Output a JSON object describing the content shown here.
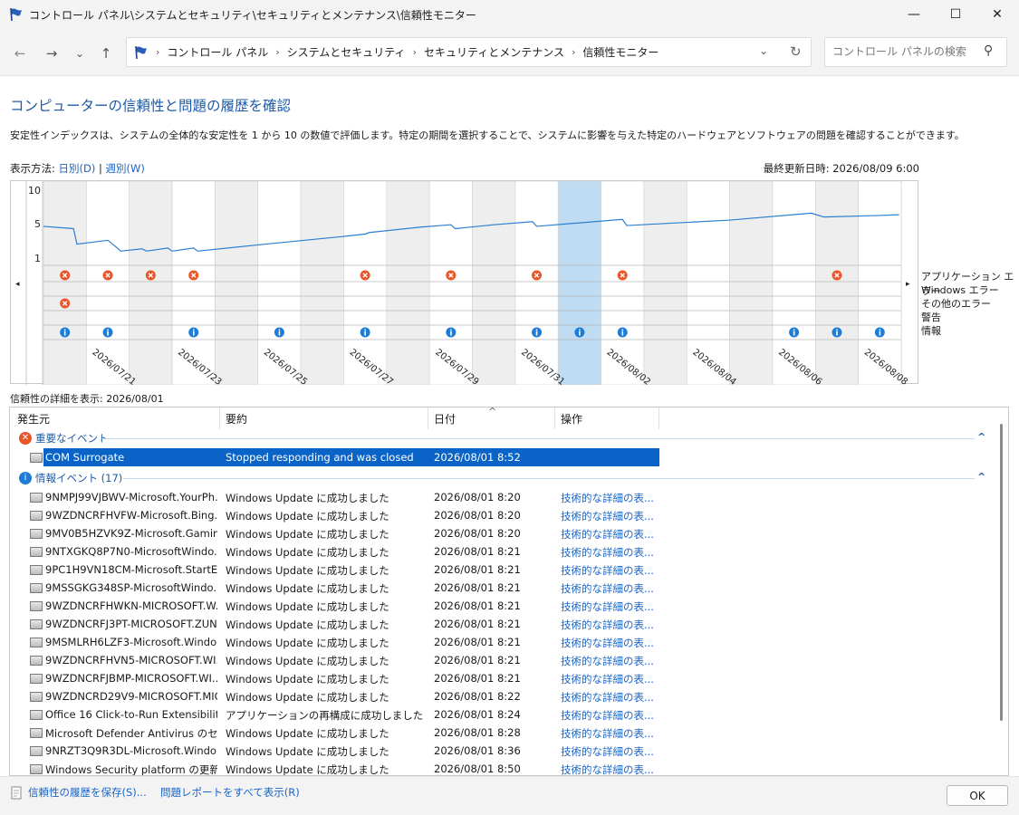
{
  "window": {
    "title": "コントロール パネル\\システムとセキュリティ\\セキュリティとメンテナンス\\信頼性モニター",
    "controls": {
      "minimize": "—",
      "maximize": "☐",
      "close": "✕"
    }
  },
  "nav": {
    "back": "←",
    "forward": "→",
    "recent": "⌄",
    "up": "↑",
    "breadcrumbs": [
      "コントロール パネル",
      "システムとセキュリティ",
      "セキュリティとメンテナンス",
      "信頼性モニター"
    ],
    "dropdown": "⌄",
    "refresh": "↻",
    "search_placeholder": "コントロール パネルの検索",
    "search_icon": "⚲"
  },
  "page": {
    "heading": "コンピューターの信頼性と問題の履歴を確認",
    "description": "安定性インデックスは、システムの全体的な安定性を 1 から 10 の数値で評価します。特定の期間を選択することで、システムに影響を与えた特定のハードウェアとソフトウェアの問題を確認することができます。",
    "view_label": "表示方法:",
    "view_daily": "日別(D)",
    "view_sep": "|",
    "view_weekly": "週別(W)",
    "last_updated_label": "最終更新日時:",
    "last_updated_value": "2026/08/09 6:00",
    "detail_label": "信頼性の詳細を表示:",
    "detail_date": "2026/08/01"
  },
  "chart_data": {
    "type": "line",
    "y_ticks": [
      "10",
      "5",
      "1"
    ],
    "ylim": [
      1,
      10
    ],
    "x_tick_labels": [
      "2026/07/21",
      "2026/07/23",
      "2026/07/25",
      "2026/07/27",
      "2026/07/29",
      "2026/07/31",
      "2026/08/02",
      "2026/08/04",
      "2026/08/06",
      "2026/08/08"
    ],
    "selected_day": "2026/08/01",
    "legend": [
      "アプリケーション エラー",
      "Windows エラー",
      "その他のエラー",
      "警告",
      "情報"
    ],
    "scroll_left": "◂",
    "scroll_right": "▸"
  },
  "list": {
    "columns": [
      "発生元",
      "要約",
      "日付",
      "操作"
    ],
    "sort_indicator": "^",
    "critical_group": {
      "label": "重要なイベント",
      "icon": "✕",
      "collapse": "^"
    },
    "info_group": {
      "label": "情報イベント (17)",
      "icon": "i",
      "collapse": "^"
    },
    "critical_rows": [
      {
        "source": "COM Surrogate",
        "summary": "Stopped responding and was closed",
        "date": "2026/08/01 8:52",
        "action": ""
      }
    ],
    "info_rows": [
      {
        "source": "9NMPJ99VJBWV-Microsoft.YourPh...",
        "summary": "Windows Update に成功しました",
        "date": "2026/08/01 8:20",
        "action": "技術的な詳細の表..."
      },
      {
        "source": "9WZDNCRFHVFW-Microsoft.Bing...",
        "summary": "Windows Update に成功しました",
        "date": "2026/08/01 8:20",
        "action": "技術的な詳細の表..."
      },
      {
        "source": "9MV0B5HZVK9Z-Microsoft.Gamin...",
        "summary": "Windows Update に成功しました",
        "date": "2026/08/01 8:20",
        "action": "技術的な詳細の表..."
      },
      {
        "source": "9NTXGKQ8P7N0-MicrosoftWindo...",
        "summary": "Windows Update に成功しました",
        "date": "2026/08/01 8:21",
        "action": "技術的な詳細の表..."
      },
      {
        "source": "9PC1H9VN18CM-Microsoft.StartE...",
        "summary": "Windows Update に成功しました",
        "date": "2026/08/01 8:21",
        "action": "技術的な詳細の表..."
      },
      {
        "source": "9MSSGKG348SP-MicrosoftWindo...",
        "summary": "Windows Update に成功しました",
        "date": "2026/08/01 8:21",
        "action": "技術的な詳細の表..."
      },
      {
        "source": "9WZDNCRFHWKN-MICROSOFT.W...",
        "summary": "Windows Update に成功しました",
        "date": "2026/08/01 8:21",
        "action": "技術的な詳細の表..."
      },
      {
        "source": "9WZDNCRFJ3PT-MICROSOFT.ZUN...",
        "summary": "Windows Update に成功しました",
        "date": "2026/08/01 8:21",
        "action": "技術的な詳細の表..."
      },
      {
        "source": "9MSMLRH6LZF3-Microsoft.Windo...",
        "summary": "Windows Update に成功しました",
        "date": "2026/08/01 8:21",
        "action": "技術的な詳細の表..."
      },
      {
        "source": "9WZDNCRFHVN5-MICROSOFT.WI...",
        "summary": "Windows Update に成功しました",
        "date": "2026/08/01 8:21",
        "action": "技術的な詳細の表..."
      },
      {
        "source": "9WZDNCRFJBMP-MICROSOFT.WI...",
        "summary": "Windows Update に成功しました",
        "date": "2026/08/01 8:21",
        "action": "技術的な詳細の表..."
      },
      {
        "source": "9WZDNCRD29V9-MICROSOFT.MIC...",
        "summary": "Windows Update に成功しました",
        "date": "2026/08/01 8:22",
        "action": "技術的な詳細の表..."
      },
      {
        "source": "Office 16 Click-to-Run Extensibilit...",
        "summary": "アプリケーションの再構成に成功しました",
        "date": "2026/08/01 8:24",
        "action": "技術的な詳細の表..."
      },
      {
        "source": "Microsoft Defender Antivirus のセ...",
        "summary": "Windows Update に成功しました",
        "date": "2026/08/01 8:28",
        "action": "技術的な詳細の表..."
      },
      {
        "source": "9NRZT3Q9R3DL-Microsoft.Windo...",
        "summary": "Windows Update に成功しました",
        "date": "2026/08/01 8:36",
        "action": "技術的な詳細の表..."
      },
      {
        "source": "Windows Security platform の更新...",
        "summary": "Windows Update に成功しました",
        "date": "2026/08/01 8:50",
        "action": "技術的な詳細の表..."
      }
    ]
  },
  "footer": {
    "save_history": "信頼性の履歴を保存(S)...",
    "view_all_reports": "問題レポートをすべて表示(R)",
    "ok": "OK"
  },
  "colors": {
    "accent": "#1e5aa8",
    "link": "#1a64c8",
    "selected": "#0a64c8",
    "error": "#e8562a",
    "info": "#1c7cd6",
    "line": "#2a7fd0",
    "highlight": "#bfdcf2"
  }
}
